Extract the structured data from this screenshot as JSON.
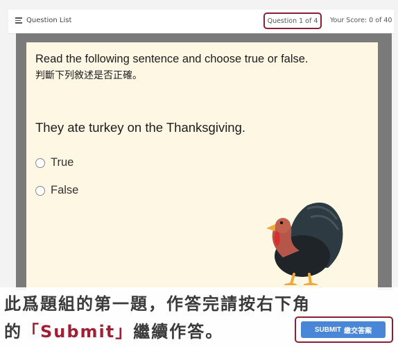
{
  "header": {
    "question_list_label": "Question List",
    "question_counter": "Question 1 of 4",
    "score": "Your Score: 0 of 40"
  },
  "question": {
    "instruction_en": "Read the following sentence and choose true or false.",
    "instruction_zh": "判斷下列敘述是否正確。",
    "sentence": "They ate turkey on the Thanksgiving.",
    "options": [
      {
        "label": "True"
      },
      {
        "label": "False"
      }
    ],
    "image_icon": "turkey-illustration"
  },
  "caption": {
    "line1": "此爲題組的第一題，作答完請按右下角",
    "line2_prefix": "的",
    "line2_accent": "「Submit」",
    "line2_suffix": "繼續作答。"
  },
  "submit": {
    "label_en": "SUBMIT",
    "label_zh": "繳交答案"
  },
  "colors": {
    "highlight_border": "#8a1f33",
    "submit_button": "#4a86d8",
    "card_background": "#fdf7e4",
    "frame_background": "#7a7a7a",
    "caption_accent": "#a01f35"
  }
}
